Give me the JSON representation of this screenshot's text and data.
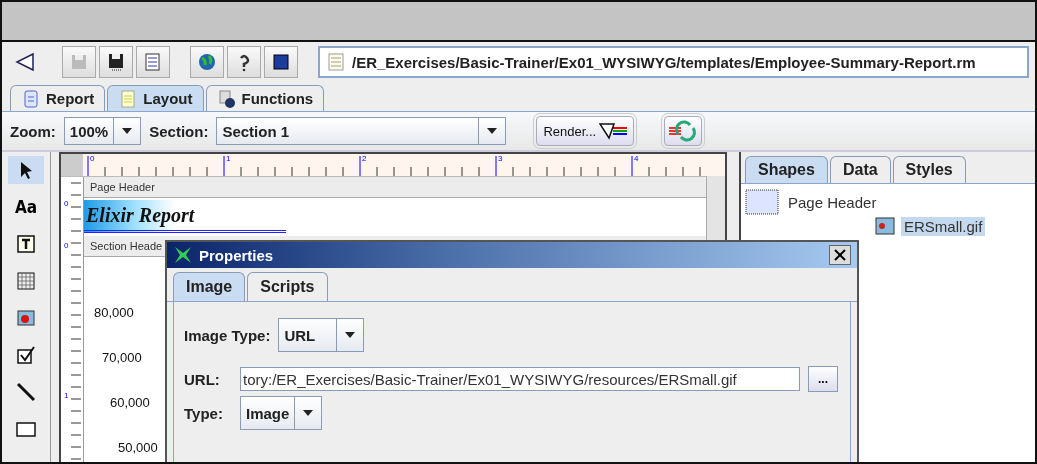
{
  "toolbar": {
    "path": "/ER_Exercises/Basic-Trainer/Ex01_WYSIWYG/templates/Employee-Summary-Report.rm"
  },
  "tabs": [
    {
      "label": "Report",
      "selected": false
    },
    {
      "label": "Layout",
      "selected": true
    },
    {
      "label": "Functions",
      "selected": false
    }
  ],
  "zoom": {
    "label": "Zoom:",
    "value": "100%"
  },
  "section": {
    "label": "Section:",
    "value": "Section 1"
  },
  "render_button": "Render...",
  "palette": {
    "text_tool": "Aa"
  },
  "ruler": {
    "labels": [
      "0",
      "1",
      "2",
      "3",
      "4"
    ]
  },
  "vertical_ruler": {
    "labels": [
      "0",
      "0",
      "1"
    ]
  },
  "bands": [
    {
      "label": "Page Header"
    },
    {
      "label": "Section Heade"
    }
  ],
  "report_title": "Elixir Report",
  "axis_labels": [
    "80,000",
    "70,000",
    "60,000",
    "50,000"
  ],
  "right_tabs": [
    {
      "label": "Shapes",
      "selected": true
    },
    {
      "label": "Data",
      "selected": false
    },
    {
      "label": "Styles",
      "selected": false
    }
  ],
  "tree": [
    {
      "label": "Page Header",
      "selected": false,
      "children": [
        {
          "label": "ERSmall.gif",
          "selected": true
        }
      ]
    }
  ],
  "dialog": {
    "title": "Properties",
    "tabs": [
      {
        "label": "Image",
        "selected": true
      },
      {
        "label": "Scripts",
        "selected": false
      }
    ],
    "image_type": {
      "label": "Image Type:",
      "value": "URL"
    },
    "url": {
      "label": "URL:",
      "value": "tory:/ER_Exercises/Basic-Trainer/Ex01_WYSIWYG/resources/ERSmall.gif",
      "browse": "..."
    },
    "type": {
      "label": "Type:",
      "value": "Image"
    }
  }
}
